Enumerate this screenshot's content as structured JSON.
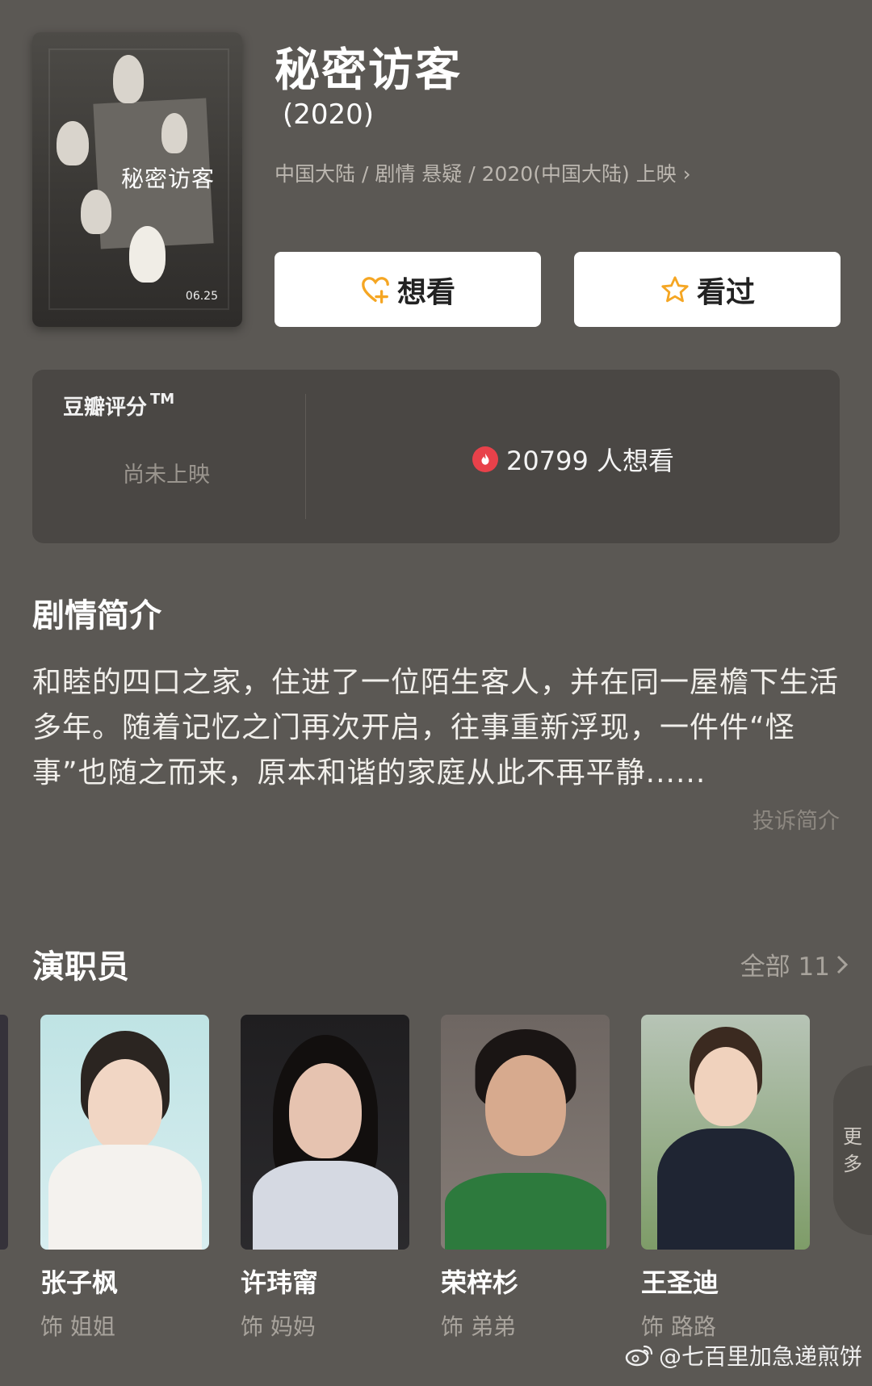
{
  "movie": {
    "title": "秘密访客",
    "year": "(2020)",
    "meta": "中国大陆 / 剧情 悬疑 / 2020(中国大陆) 上映 ›",
    "poster": {
      "title": "秘密访客",
      "date": "06.25"
    }
  },
  "actions": {
    "want_label": "想看",
    "seen_label": "看过"
  },
  "rating": {
    "label": "豆瓣评分",
    "tm": "TM",
    "status": "尚未上映",
    "wish_count": "20799 人想看"
  },
  "synopsis": {
    "heading": "剧情简介",
    "text": "和睦的四口之家，住进了一位陌生客人，并在同一屋檐下生活多年。随着记忆之门再次开启，往事重新浮现，一件件“怪事”也随之而来，原本和谐的家庭从此不再平静......",
    "report_link": "投诉简介"
  },
  "cast": {
    "heading": "演职员",
    "all_label": "全部 11",
    "more_label_1": "更",
    "more_label_2": "多",
    "members": [
      {
        "name": "张子枫",
        "role": "饰 姐姐"
      },
      {
        "name": "许玮甯",
        "role": "饰 妈妈"
      },
      {
        "name": "荣梓杉",
        "role": "饰 弟弟"
      },
      {
        "name": "王圣迪",
        "role": "饰 路路"
      }
    ]
  },
  "watermark": "@七百里加急递煎饼",
  "icons": {
    "want": "heart-plus-icon",
    "seen": "star-icon",
    "wish": "flame-icon",
    "chevron": "chevron-right-icon",
    "weibo": "weibo-icon"
  },
  "colors": {
    "accent": "#f5a623",
    "flame": "#e8414a",
    "background": "#5b5854"
  }
}
